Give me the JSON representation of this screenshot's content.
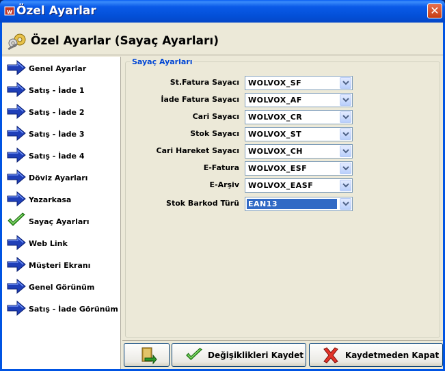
{
  "window": {
    "title": "Özel Ayarlar",
    "close_label": "✕"
  },
  "header": {
    "title": "Özel Ayarlar (Sayaç Ayarları)"
  },
  "nav": {
    "items": [
      {
        "label": "Genel Ayarlar",
        "icon": "blue-arrow-icon"
      },
      {
        "label": "Satış - İade 1",
        "icon": "blue-arrow-icon"
      },
      {
        "label": "Satış - İade 2",
        "icon": "blue-arrow-icon"
      },
      {
        "label": "Satış - İade 3",
        "icon": "blue-arrow-icon"
      },
      {
        "label": "Satış - İade 4",
        "icon": "blue-arrow-icon"
      },
      {
        "label": "Döviz Ayarları",
        "icon": "blue-arrow-icon"
      },
      {
        "label": "Yazarkasa",
        "icon": "blue-arrow-icon"
      },
      {
        "label": "Sayaç Ayarları",
        "icon": "green-check-icon",
        "active": true
      },
      {
        "label": "Web Link",
        "icon": "blue-arrow-icon"
      },
      {
        "label": "Müşteri Ekranı",
        "icon": "blue-arrow-icon"
      },
      {
        "label": "Genel Görünüm",
        "icon": "blue-arrow-icon"
      },
      {
        "label": "Satış - İade Görünüm",
        "icon": "blue-arrow-icon"
      }
    ]
  },
  "group": {
    "legend": "Sayaç Ayarları",
    "rows": [
      {
        "label": "St.Fatura Sayacı",
        "value": "WOLVOX_SF"
      },
      {
        "label": "İade Fatura Sayacı",
        "value": "WOLVOX_AF"
      },
      {
        "label": "Cari Sayacı",
        "value": "WOLVOX_CR"
      },
      {
        "label": "Stok Sayacı",
        "value": "WOLVOX_ST"
      },
      {
        "label": "Cari Hareket Sayacı",
        "value": "WOLVOX_CH"
      },
      {
        "label": "E-Fatura",
        "value": "WOLVOX_ESF"
      },
      {
        "label": "E-Arşiv",
        "value": "WOLVOX_EASF"
      },
      {
        "label": "Stok Barkod Türü",
        "value": "EAN13",
        "selected": true
      }
    ]
  },
  "footer": {
    "save_label": "Değişiklikleri Kaydet",
    "close_label": "Kaydetmeden Kapat"
  },
  "colors": {
    "titlebar": "#0054e3",
    "legend": "#0046d5",
    "selection": "#316ac5",
    "arrow": "#1f3fb8"
  }
}
